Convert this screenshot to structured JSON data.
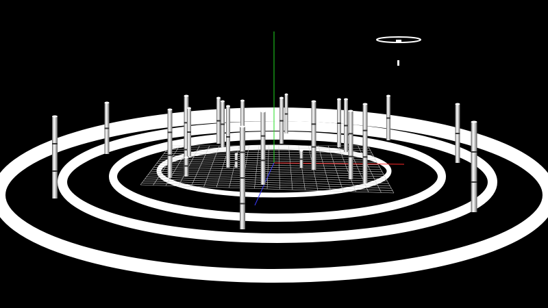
{
  "viewport": {
    "background": "#000000",
    "scene": "3d-viewport"
  },
  "colors": {
    "ring": "#ffffff",
    "grid": "#cfcfcf",
    "axis_x": "#ff2a2a",
    "axis_y": "#22dd22",
    "axis_z": "#3a3aff",
    "pole_light": "#f2f2f2",
    "pole_dark": "#6a6a6a"
  },
  "objects": {
    "rings": 4,
    "poles": 24,
    "floating_ring": 1,
    "grid": 1,
    "axes": [
      "x",
      "y",
      "z"
    ]
  }
}
